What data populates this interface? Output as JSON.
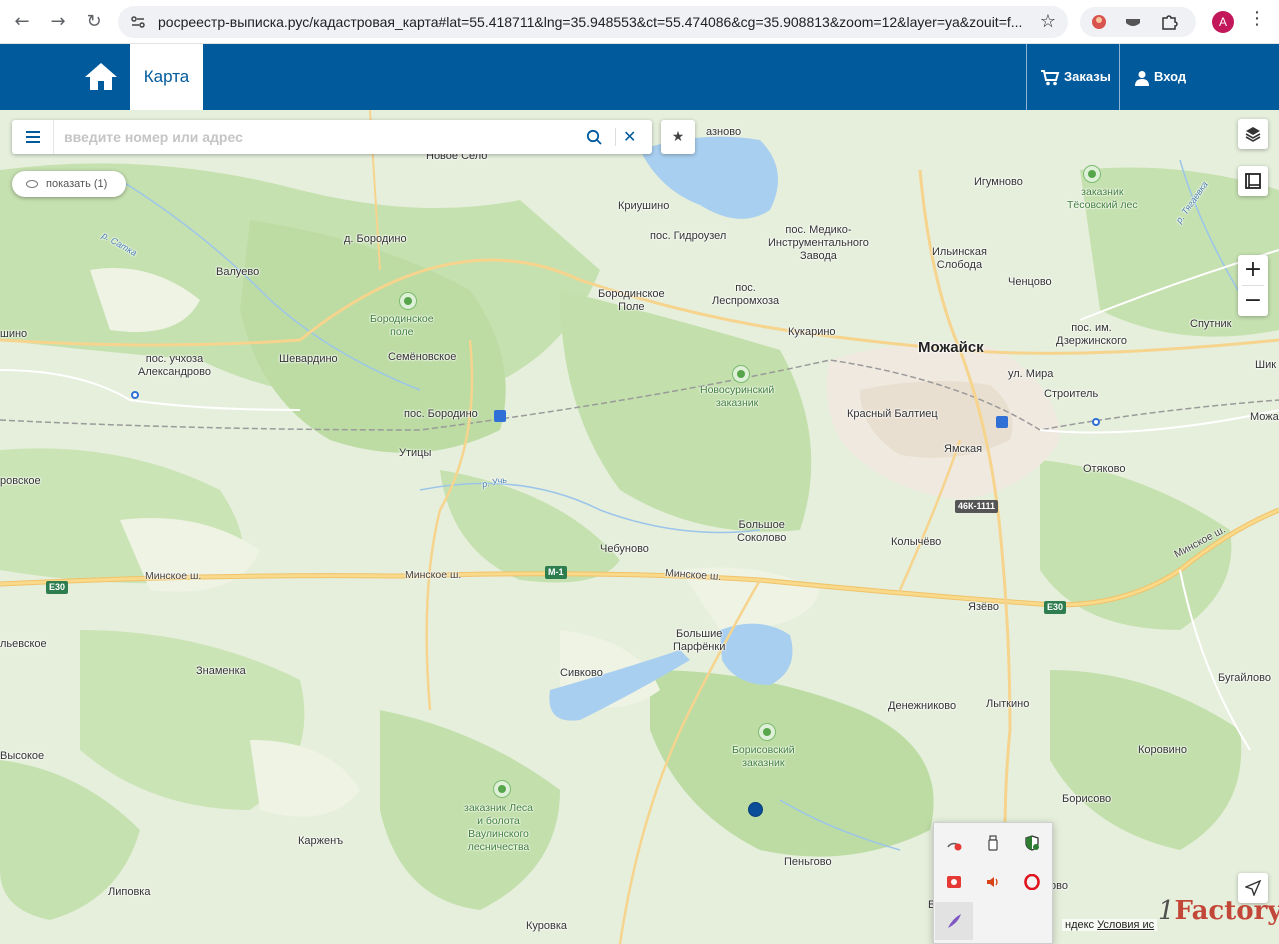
{
  "browser": {
    "url": "росреестр-выписка.рус/кадастровая_карта#lat=55.418711&lng=35.948553&ct=55.474086&cg=35.908813&zoom=12&layer=ya&zouit=f...",
    "avatar_letter": "A",
    "icons": [
      "back-arrow-icon",
      "forward-arrow-icon",
      "reload-icon",
      "site-settings-icon",
      "bookmark-star-icon",
      "extension-icon",
      "menu-dots-icon"
    ]
  },
  "header": {
    "tab_map": "Карта",
    "orders": "Заказы",
    "login": "Вход",
    "brand_color": "#005a9c"
  },
  "search": {
    "placeholder": "введите номер или адрес",
    "value": ""
  },
  "show_button": "показать (1)",
  "zoom": {
    "in": "+",
    "out": "−"
  },
  "attribution": {
    "prefix": "ндекс",
    "terms": "Условия ис"
  },
  "watermark": {
    "pre": "1",
    "brand": "Factory"
  },
  "map_labels": {
    "mozhaysk": "Можайск",
    "novoe_selo": "Новое Село",
    "krivo": "азново",
    "kriushino": "Криушино",
    "gidrouzel": "пос. Гидроузел",
    "med_zavod": "пос. Медико-\nИнструментального\nЗавода",
    "igumnovo": "Игумново",
    "tesovsky": "заказник\nТёсовский лес",
    "d_borodino": "д. Бородино",
    "valuevo": "Валуево",
    "borodinskoe_pole_park": "Бородинское\nполе",
    "borodinskoe_pole": "Бородинское\nПоле",
    "lesprom": "пос.\nЛеспромхоза",
    "ilinskaya": "Ильинская\nСлобода",
    "chentsovo": "Ченцово",
    "shino": "шино",
    "kukarino": "Кукарино",
    "dzerzh": "пос. им.\nДзержинского",
    "sputnik": "Спутник",
    "aleksandrovo": "пос. учхоза\nАлександрово",
    "shevardino": "Шевардино",
    "semenovskoe": "Семёновское",
    "novosurinsky": "Новосуринский\nзаказник",
    "ul_mira": "ул. Мира",
    "stroitel": "Строитель",
    "shik": "Шик",
    "mozha": "Можа",
    "pos_borodino": "пос. Бородино",
    "krasny_baltiets": "Красный Балтиец",
    "yamskaya": "Ямская",
    "utitsy": "Утицы",
    "otyakovo": "Отяково",
    "rovskoe": "ровское",
    "r_uch": "р. Учь",
    "r_satka": "р. Сатка",
    "r_tyagaevka": "р. Тягаевка",
    "bolshoe_sokolovo": "Большое\nСоколово",
    "kolychevo": "Колычёво",
    "chebunovo": "Чебуново",
    "minskoe_1": "Минское ш.",
    "minskoe_2": "Минское ш.",
    "minskoe_3": "Минское ш.",
    "minskoe_4": "Минское ш.",
    "yazevo": "Язёво",
    "lvevskoe": "льевское",
    "znamenka": "Знаменка",
    "sivkovo": "Сивково",
    "b_parfenki": "Большие\nПарфёнки",
    "bugaylovo": "Бугайлово",
    "denezhnikovo": "Денежниково",
    "lytkino": "Лыткино",
    "borisovsky": "Борисовский\nзаказник",
    "vysokoe": "Высокое",
    "korovino": "Коровино",
    "vaulinsky": "заказник Леса\nи болота\nВаулинского\nлесничества",
    "borisovo": "Борисово",
    "karzhen": "Карженъ",
    "penkovo": "Пеньгово",
    "lipovka": "Липовка",
    "kurovka": "Куровка",
    "ovo": "ово",
    "v": "В"
  },
  "road_shields": {
    "e30_left": "E30",
    "e30_right": "E30",
    "m1": "М-1",
    "r46k": "46К-1111"
  },
  "tray_icons": [
    "network-warning-icon",
    "usb-drive-icon",
    "security-shield-icon",
    "screen-record-icon",
    "volume-icon",
    "opera-icon",
    "pen-feather-icon"
  ]
}
